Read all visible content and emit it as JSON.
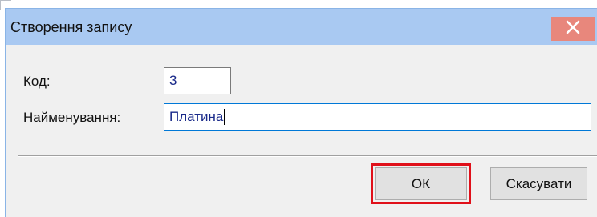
{
  "dialog": {
    "title": "Створення запису",
    "close_icon": "close-icon"
  },
  "form": {
    "code": {
      "label": "Код:",
      "value": "3"
    },
    "name": {
      "label": "Найменування:",
      "value": "Платина"
    }
  },
  "buttons": {
    "ok_label": "ОК",
    "cancel_label": "Скасувати"
  },
  "colors": {
    "titlebar": "#a9c9f2",
    "close_button": "#e8877c",
    "highlight": "#e0101a",
    "field_text": "#1a2a8a"
  }
}
